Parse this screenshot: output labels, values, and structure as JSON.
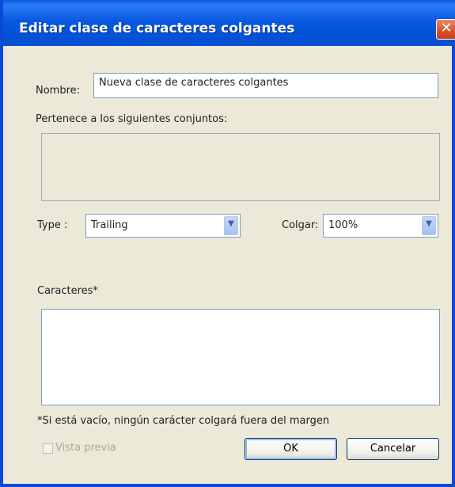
{
  "window": {
    "title": "Editar clase de caracteres colgantes",
    "close_glyph": "✕"
  },
  "form": {
    "name_label": "Nombre:",
    "name_value": "Nueva clase de caracteres colgantes",
    "sets_label": "Pertenece a los siguientes conjuntos:",
    "type_label": "Type :",
    "type_value": "Trailing",
    "hang_label": "Colgar:",
    "hang_value": "100%",
    "chars_label": "Caracteres*",
    "chars_value": "",
    "footnote": "*Si está vacío, ningún carácter colgará fuera del margen"
  },
  "footer": {
    "preview_label": "Vista previa",
    "ok_label": "OK",
    "cancel_label": "Cancelar"
  },
  "icons": {
    "dropdown": "chevron-down-icon",
    "close": "close-icon"
  },
  "colors": {
    "titlebar": "#0a58e0",
    "dialog_bg": "#ece9d8",
    "close": "#d9502a"
  }
}
